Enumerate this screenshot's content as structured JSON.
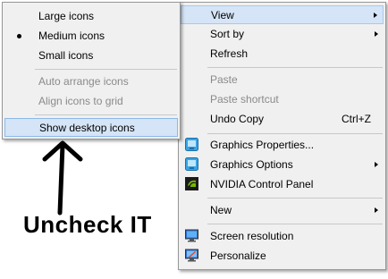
{
  "submenu": {
    "items": [
      {
        "label": "Large icons"
      },
      {
        "label": "Medium icons"
      },
      {
        "label": "Small icons"
      },
      {
        "label": "Auto arrange icons"
      },
      {
        "label": "Align icons to grid"
      },
      {
        "label": "Show desktop icons"
      }
    ]
  },
  "context_menu": {
    "items": [
      {
        "label": "View"
      },
      {
        "label": "Sort by"
      },
      {
        "label": "Refresh"
      },
      {
        "label": "Paste"
      },
      {
        "label": "Paste shortcut"
      },
      {
        "label": "Undo Copy",
        "shortcut": "Ctrl+Z"
      },
      {
        "label": "Graphics Properties..."
      },
      {
        "label": "Graphics Options"
      },
      {
        "label": "NVIDIA Control Panel"
      },
      {
        "label": "New"
      },
      {
        "label": "Screen resolution"
      },
      {
        "label": "Personalize"
      }
    ]
  },
  "annotation": {
    "text": "Uncheck IT"
  },
  "colors": {
    "menu_bg": "#f0f0f0",
    "highlight": "#d5e5f7",
    "disabled_text": "#8a8a8a"
  }
}
